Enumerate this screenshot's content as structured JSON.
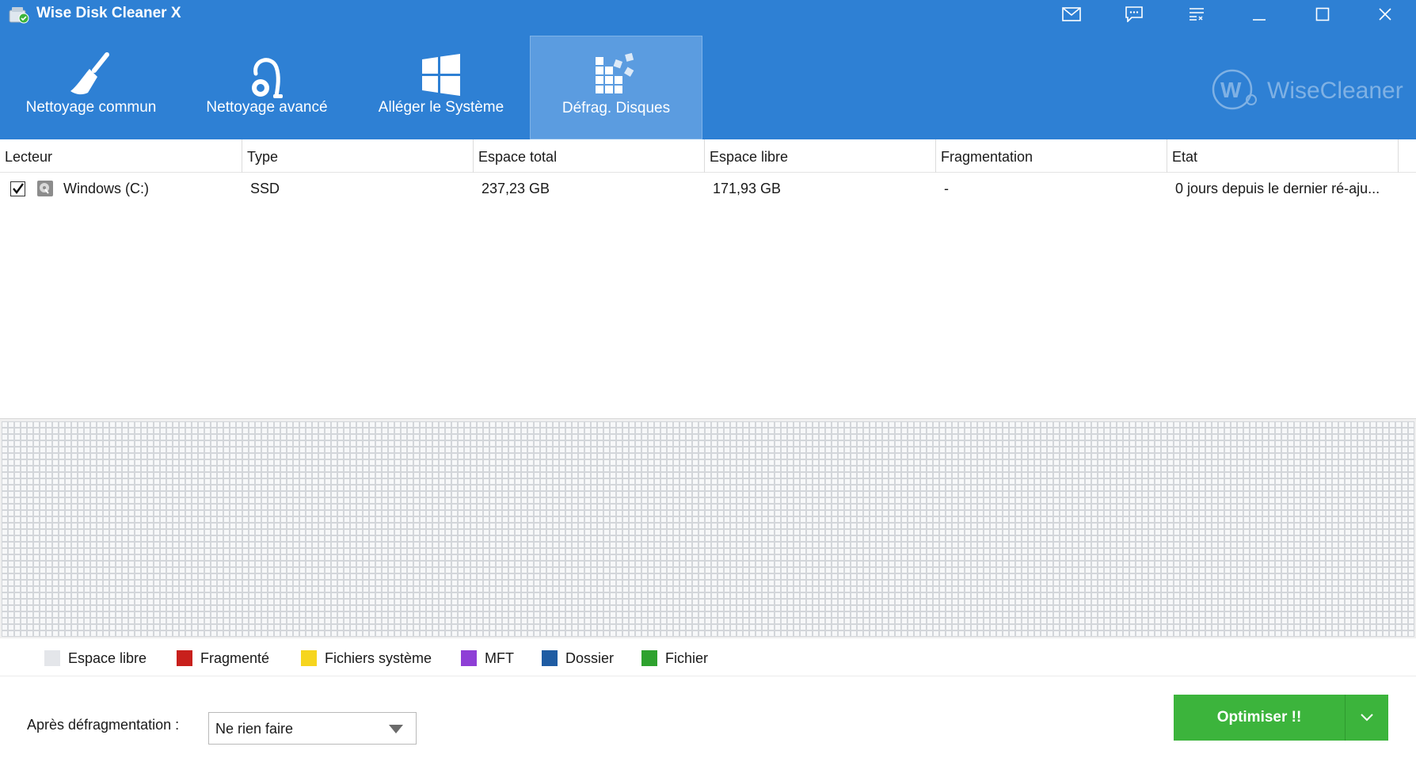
{
  "window": {
    "title": "Wise Disk Cleaner X"
  },
  "toolbar": {
    "items": [
      {
        "label": "Nettoyage commun",
        "icon": "broom-icon",
        "active": false
      },
      {
        "label": "Nettoyage avancé",
        "icon": "vacuum-icon",
        "active": false
      },
      {
        "label": "Alléger le Système",
        "icon": "windows-icon",
        "active": false
      },
      {
        "label": "Défrag. Disques",
        "icon": "defrag-icon",
        "active": true
      }
    ]
  },
  "brand": {
    "name": "WiseCleaner"
  },
  "table": {
    "columns": [
      "Lecteur",
      "Type",
      "Espace total",
      "Espace libre",
      "Fragmentation",
      "Etat"
    ],
    "rows": [
      {
        "checked": true,
        "drive": "Windows (C:)",
        "type": "SSD",
        "total": "237,23 GB",
        "free": "171,93 GB",
        "fragmentation": "-",
        "state": "0 jours depuis le dernier ré-aju..."
      }
    ]
  },
  "legend": {
    "items": [
      {
        "label": "Espace libre",
        "color": "#e4e6ea"
      },
      {
        "label": "Fragmenté",
        "color": "#c8201c"
      },
      {
        "label": "Fichiers système",
        "color": "#f6d51e"
      },
      {
        "label": "MFT",
        "color": "#8e3fd6"
      },
      {
        "label": "Dossier",
        "color": "#1f5ca3"
      },
      {
        "label": "Fichier",
        "color": "#2ea22e"
      }
    ]
  },
  "bottom": {
    "after_label": "Après défragmentation :",
    "after_value": "Ne rien faire",
    "optimize_label": "Optimiser !!"
  },
  "colors": {
    "header_bg": "#2e80d4",
    "active_tab_bg": "#5b9ce0",
    "optimize_green": "#3cb43c"
  }
}
